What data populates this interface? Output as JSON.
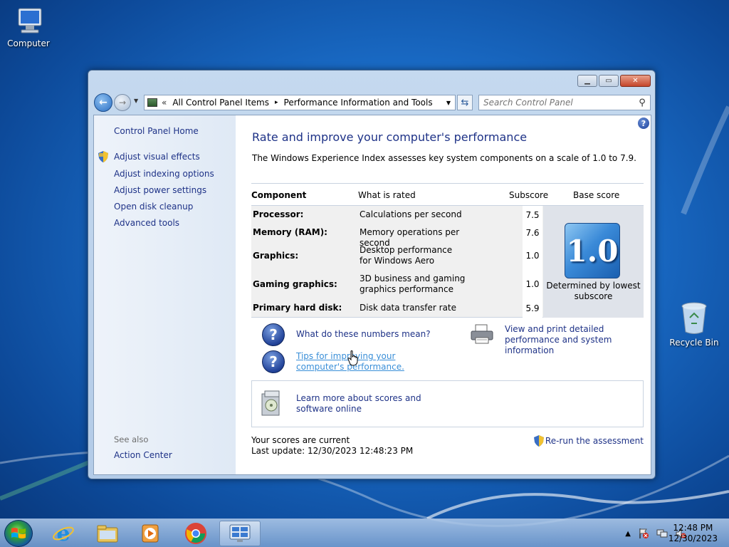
{
  "desktop": {
    "icons": [
      {
        "label": "Computer"
      },
      {
        "label": "Recycle Bin"
      }
    ]
  },
  "window": {
    "address": {
      "chevron": "«",
      "crumbs": [
        "All Control Panel Items",
        "Performance Information and Tools"
      ],
      "separator": "▸"
    },
    "search_placeholder": "Search Control Panel",
    "sidebar": {
      "home": "Control Panel Home",
      "items": [
        {
          "label": "Adjust visual effects",
          "shield": true
        },
        {
          "label": "Adjust indexing options"
        },
        {
          "label": "Adjust power settings"
        },
        {
          "label": "Open disk cleanup"
        },
        {
          "label": "Advanced tools"
        }
      ],
      "see_also_title": "See also",
      "see_also_items": [
        "Action Center"
      ]
    },
    "main": {
      "title": "Rate and improve your computer's performance",
      "intro": "The Windows Experience Index assesses key system components on a scale of 1.0 to 7.9.",
      "table": {
        "headers": {
          "component": "Component",
          "what": "What is rated",
          "subscore": "Subscore",
          "base": "Base score"
        },
        "rows": [
          {
            "component": "Processor:",
            "what": "Calculations per second",
            "subscore": "7.5"
          },
          {
            "component": "Memory (RAM):",
            "what": "Memory operations per second",
            "subscore": "7.6"
          },
          {
            "component": "Graphics:",
            "what": "Desktop performance for Windows Aero",
            "subscore": "1.0"
          },
          {
            "component": "Gaming graphics:",
            "what": "3D business and gaming graphics performance",
            "subscore": "1.0"
          },
          {
            "component": "Primary hard disk:",
            "what": "Disk data transfer rate",
            "subscore": "5.9"
          }
        ],
        "base_score": "1.0",
        "base_caption": "Determined by lowest subscore"
      },
      "links": {
        "numbers": "What do these numbers mean?",
        "tips": "Tips for improving your computer's performance.",
        "view_print": "View and print detailed performance and system information",
        "learn_more": "Learn more about scores and software online",
        "rerun": "Re-run the assessment"
      },
      "status": {
        "current": "Your scores are current",
        "last_update": "Last update: 12/30/2023 12:48:23 PM"
      }
    }
  },
  "taskbar": {
    "time": "12:48 PM",
    "date": "12/30/2023",
    "tray_up": "▲"
  },
  "colors": {
    "link": "#1e3287",
    "visited_link": "#3a8fd8",
    "desktop": "#1a6cc7"
  }
}
